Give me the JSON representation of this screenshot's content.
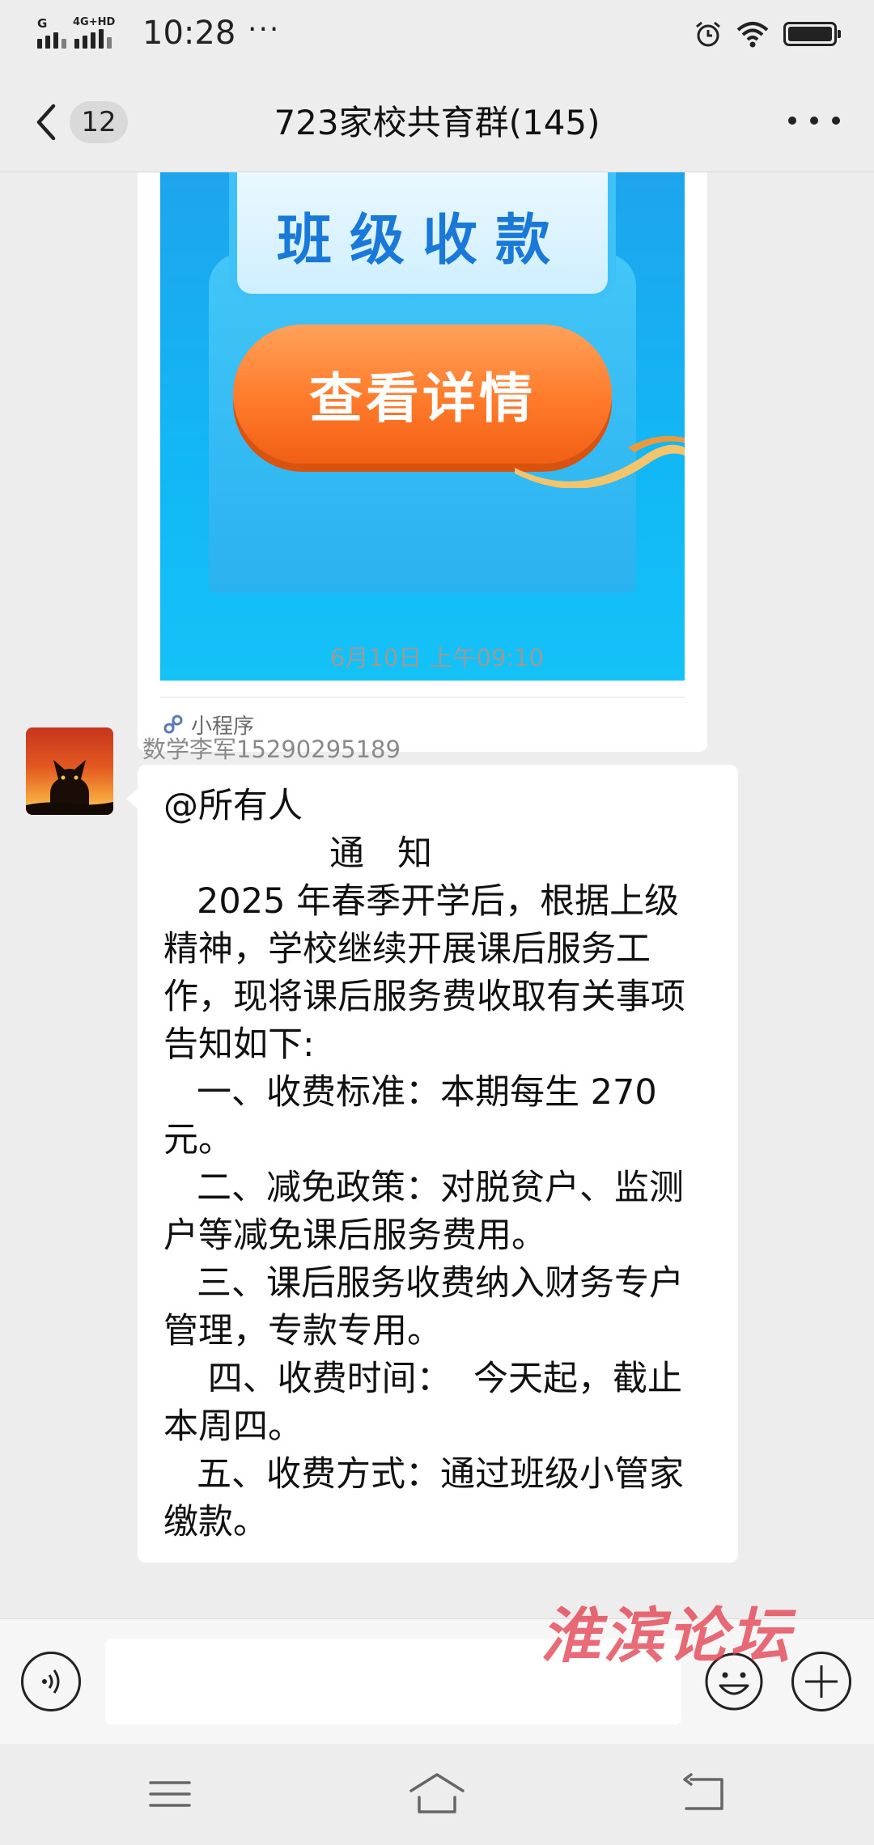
{
  "status_bar": {
    "time": "10:28",
    "overflow_dots": "···",
    "signal_label_1": "G",
    "signal_label_2": "4G+HD"
  },
  "title_bar": {
    "unread_count": "12",
    "title": "723家校共育群(145)"
  },
  "mini_program_card": {
    "banner_title": "班级收款",
    "banner_button": "查看详情",
    "footer_label": "小程序"
  },
  "timestamp": "6月10日 上午09:10",
  "message": {
    "sender": "数学李军15290295189",
    "lines": [
      "@所有人",
      "               通   知",
      "   2025 年春季开学后，根据上级",
      "精神，学校继续开展课后服务工",
      "作，现将课后服务费收取有关事项",
      "告知如下:",
      "   一、收费标准：本期每生 270",
      "元。",
      "   二、减免政策：对脱贫户、监测",
      "户等减免课后服务费用。",
      "   三、课后服务收费纳入财务专户",
      "管理，专款专用。",
      "    四、收费时间：  今天起，截止",
      "本周四。",
      "   五、收费方式：通过班级小管家",
      "缴款。"
    ]
  },
  "input_bar": {
    "value": "",
    "placeholder": ""
  },
  "watermark": "淮滨论坛",
  "colors": {
    "background": "#ededed",
    "bubble": "#ffffff",
    "button_orange": "#ff7a2a",
    "banner_blue": "#1ea3ec",
    "watermark_red": "#e23a4a"
  }
}
